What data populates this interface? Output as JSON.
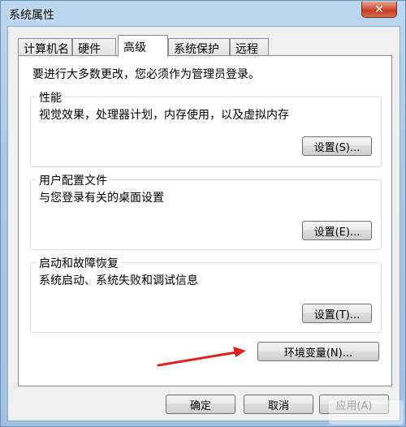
{
  "window": {
    "title": "系统属性",
    "close_symbol": "✕"
  },
  "tabs": [
    {
      "label": "计算机名"
    },
    {
      "label": "硬件"
    },
    {
      "label": "高级"
    },
    {
      "label": "系统保护"
    },
    {
      "label": "远程"
    }
  ],
  "active_tab": "高级",
  "panel": {
    "notice": "要进行大多数更改，您必须作为管理员登录。",
    "performance": {
      "title": "性能",
      "description": "视觉效果，处理器计划，内存使用，以及虚拟内存",
      "button": "设置(S)..."
    },
    "user_profiles": {
      "title": "用户配置文件",
      "description": "与您登录有关的桌面设置",
      "button": "设置(E)..."
    },
    "startup_recovery": {
      "title": "启动和故障恢复",
      "description": "系统启动、系统失败和调试信息",
      "button": "设置(T)..."
    },
    "env_button": "环境变量(N)..."
  },
  "footer": {
    "ok": "确定",
    "cancel": "取消",
    "apply": "应用(A)"
  },
  "colors": {
    "annotation_arrow": "#e02020",
    "close_button": "#c23a20"
  }
}
